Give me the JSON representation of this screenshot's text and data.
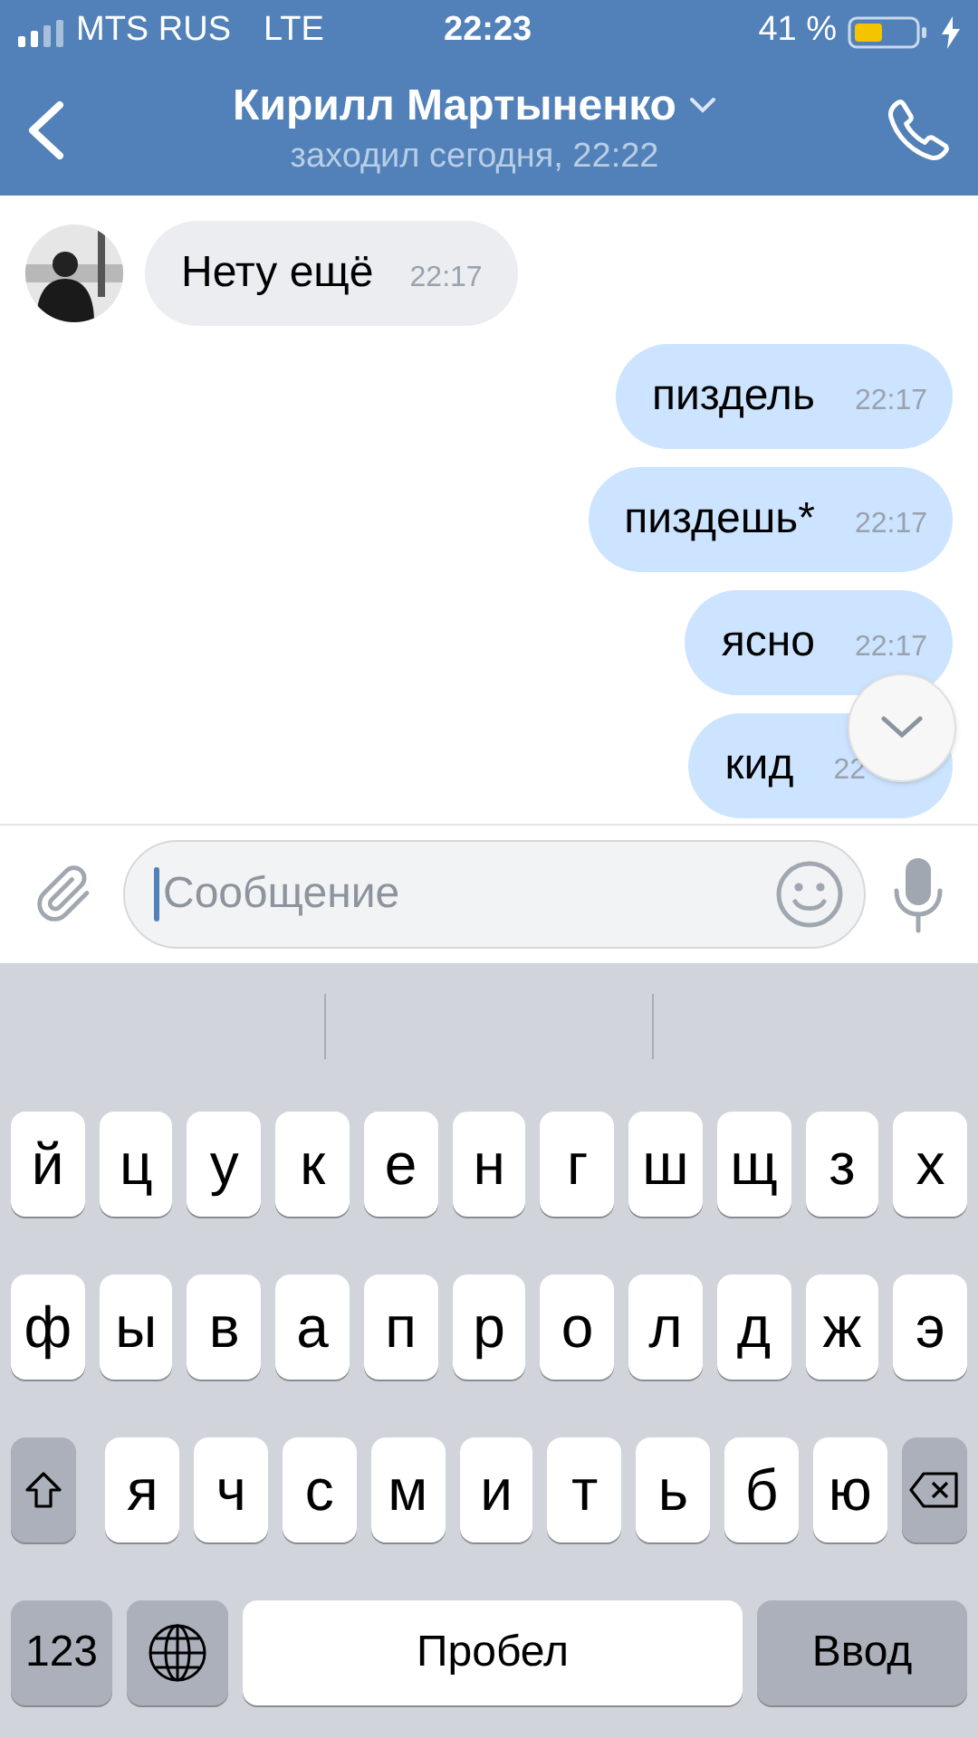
{
  "status_bar": {
    "carrier": "MTS RUS",
    "network": "LTE",
    "time": "22:23",
    "battery": "41 %"
  },
  "header": {
    "title": "Кирилл Мартыненко",
    "subtitle": "заходил сегодня, 22:22"
  },
  "messages": [
    {
      "kind": "incoming",
      "text": "Нету ещё",
      "time": "22:17"
    },
    {
      "kind": "outgoing",
      "text": "пиздель",
      "time": "22:17"
    },
    {
      "kind": "outgoing",
      "text": "пиздешь*",
      "time": "22:17"
    },
    {
      "kind": "outgoing",
      "text": "ясно",
      "time": "22:17"
    },
    {
      "kind": "outgoing",
      "text": "кид",
      "time": "22"
    }
  ],
  "composer": {
    "placeholder": "Сообщение"
  },
  "keyboard": {
    "row_1": [
      {
        "kind": "letter",
        "label": "й"
      },
      {
        "kind": "letter",
        "label": "ц"
      },
      {
        "kind": "letter",
        "label": "у"
      },
      {
        "kind": "letter",
        "label": "к"
      },
      {
        "kind": "letter",
        "label": "е"
      },
      {
        "kind": "letter",
        "label": "н"
      },
      {
        "kind": "letter",
        "label": "г"
      },
      {
        "kind": "letter",
        "label": "ш"
      },
      {
        "kind": "letter",
        "label": "щ"
      },
      {
        "kind": "letter",
        "label": "з"
      },
      {
        "kind": "letter",
        "label": "х"
      }
    ],
    "row_2": [
      {
        "kind": "letter",
        "label": "ф"
      },
      {
        "kind": "letter",
        "label": "ы"
      },
      {
        "kind": "letter",
        "label": "в"
      },
      {
        "kind": "letter",
        "label": "а"
      },
      {
        "kind": "letter",
        "label": "п"
      },
      {
        "kind": "letter",
        "label": "р"
      },
      {
        "kind": "letter",
        "label": "о"
      },
      {
        "kind": "letter",
        "label": "л"
      },
      {
        "kind": "letter",
        "label": "д"
      },
      {
        "kind": "letter",
        "label": "ж"
      },
      {
        "kind": "letter",
        "label": "э"
      }
    ],
    "row_3": [
      {
        "kind": "shift"
      },
      {
        "kind": "letter",
        "label": "я"
      },
      {
        "kind": "letter",
        "label": "ч"
      },
      {
        "kind": "letter",
        "label": "с"
      },
      {
        "kind": "letter",
        "label": "м"
      },
      {
        "kind": "letter",
        "label": "и"
      },
      {
        "kind": "letter",
        "label": "т"
      },
      {
        "kind": "letter",
        "label": "ь"
      },
      {
        "kind": "letter",
        "label": "б"
      },
      {
        "kind": "letter",
        "label": "ю"
      },
      {
        "kind": "backspace"
      }
    ],
    "row_4": [
      {
        "kind": "mode",
        "label": "123"
      },
      {
        "kind": "globe"
      },
      {
        "kind": "space",
        "label": "Пробел"
      },
      {
        "kind": "return",
        "label": "Ввод"
      }
    ]
  }
}
